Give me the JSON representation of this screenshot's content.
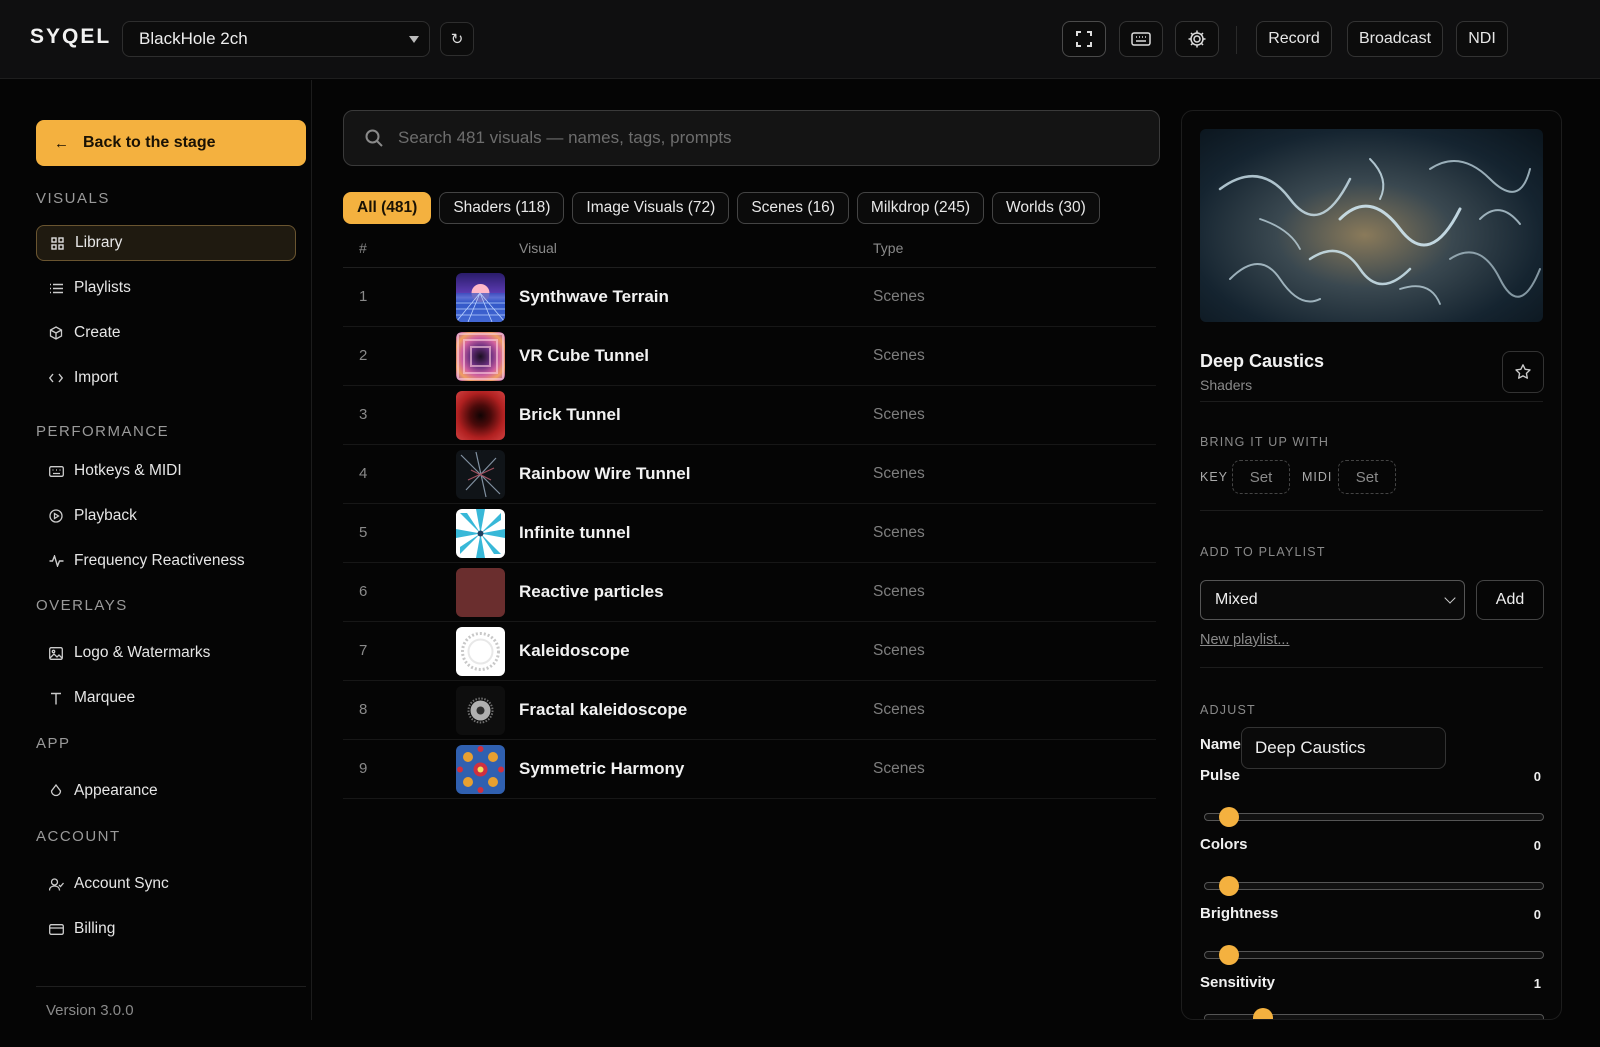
{
  "app": {
    "logo": "SYQEL",
    "device": "BlackHole 2ch",
    "refresh_glyph": "↻",
    "top_actions": [
      "Record",
      "Broadcast",
      "NDI"
    ],
    "accent": "#f4b13f"
  },
  "sidebar": {
    "back_label": "Back to the stage",
    "sections": {
      "visuals": "VISUALS",
      "performance": "PERFORMANCE",
      "overlays": "OVERLAYS",
      "app": "APP",
      "account": "ACCOUNT"
    },
    "items": {
      "library": "Library",
      "playlists": "Playlists",
      "create": "Create",
      "import": "Import",
      "hotkeys": "Hotkeys & MIDI",
      "playback": "Playback",
      "frequency": "Frequency Reactiveness",
      "logo": "Logo & Watermarks",
      "marquee": "Marquee",
      "appearance": "Appearance",
      "account_sync": "Account Sync",
      "billing": "Billing"
    },
    "version": "Version 3.0.0"
  },
  "main": {
    "search_placeholder": "Search 481 visuals — names, tags, prompts",
    "filters": [
      "All (481)",
      "Shaders (118)",
      "Image Visuals (72)",
      "Scenes (16)",
      "Milkdrop (245)",
      "Worlds (30)"
    ],
    "columns": {
      "num": "#",
      "visual": "Visual",
      "type": "Type"
    },
    "rows": [
      {
        "num": "1",
        "name": "Synthwave Terrain",
        "type": "Scenes"
      },
      {
        "num": "2",
        "name": "VR Cube Tunnel",
        "type": "Scenes"
      },
      {
        "num": "3",
        "name": "Brick Tunnel",
        "type": "Scenes"
      },
      {
        "num": "4",
        "name": "Rainbow Wire Tunnel",
        "type": "Scenes"
      },
      {
        "num": "5",
        "name": "Infinite tunnel",
        "type": "Scenes"
      },
      {
        "num": "6",
        "name": "Reactive particles",
        "type": "Scenes"
      },
      {
        "num": "7",
        "name": "Kaleidoscope",
        "type": "Scenes"
      },
      {
        "num": "8",
        "name": "Fractal kaleidoscope",
        "type": "Scenes"
      },
      {
        "num": "9",
        "name": "Symmetric Harmony",
        "type": "Scenes"
      }
    ]
  },
  "panel": {
    "title": "Deep Caustics",
    "subtitle": "Shaders",
    "bring_label": "BRING IT UP WITH",
    "key_label": "KEY",
    "midi_label": "MIDI",
    "set_label": "Set",
    "playlist_label": "ADD TO PLAYLIST",
    "playlist_value": "Mixed",
    "add_label": "Add",
    "new_playlist": "New playlist...",
    "adjust_label": "ADJUST",
    "name_label": "Name",
    "name_value": "Deep Caustics",
    "sliders": [
      {
        "label": "Pulse",
        "value": "0"
      },
      {
        "label": "Colors",
        "value": "0"
      },
      {
        "label": "Brightness",
        "value": "0"
      },
      {
        "label": "Sensitivity",
        "value": "1"
      }
    ]
  }
}
